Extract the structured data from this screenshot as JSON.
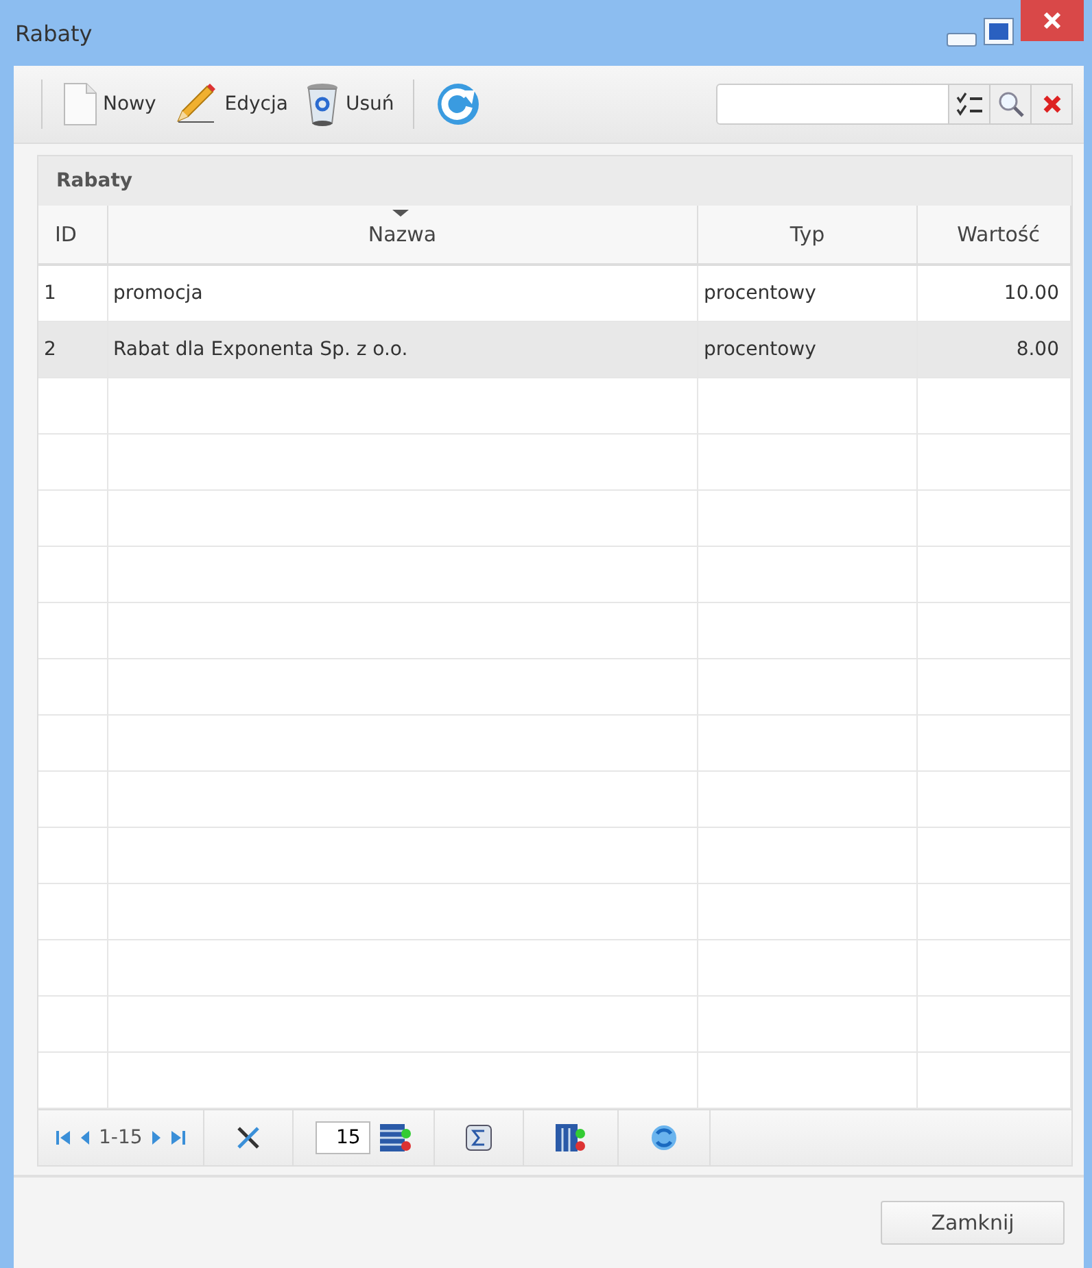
{
  "window": {
    "title": "Rabaty"
  },
  "toolbar": {
    "buttons": [
      {
        "kind": "new",
        "label": "Nowy"
      },
      {
        "kind": "edit",
        "label": "Edycja"
      },
      {
        "kind": "delete",
        "label": "Usuń"
      },
      {
        "kind": "refresh"
      }
    ]
  },
  "grid": {
    "title": "Rabaty",
    "columns": [
      {
        "label": "ID",
        "sorted": false
      },
      {
        "label": "Nazwa",
        "sorted": true
      },
      {
        "label": "Typ",
        "sorted": false
      },
      {
        "label": "Wartość",
        "sorted": false
      }
    ],
    "rows": [
      {
        "cells": [
          "1",
          "promocja",
          "procentowy",
          "10.00"
        ],
        "selected": false
      },
      {
        "cells": [
          "2",
          "Rabat dla Exponenta Sp. z o.o.",
          "procentowy",
          "8.00"
        ],
        "selected": true
      }
    ]
  },
  "paging": {
    "range": "1-15",
    "page_size": "15"
  },
  "buttons": [
    "Zamknij"
  ]
}
